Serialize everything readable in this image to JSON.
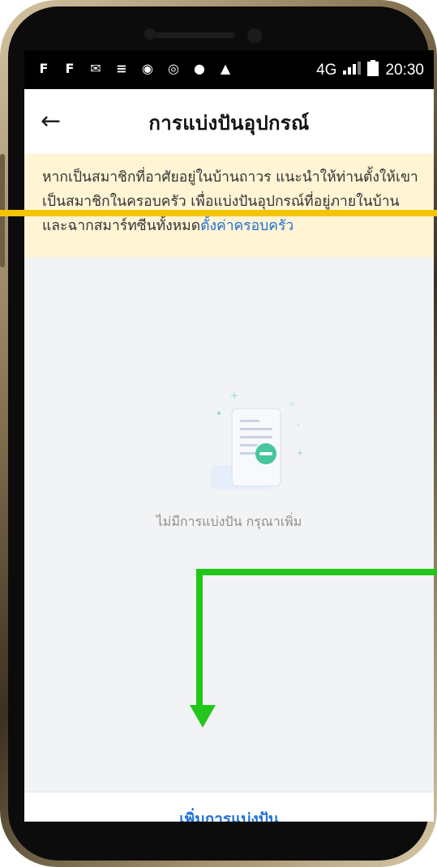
{
  "status_bar": {
    "icons": [
      "F",
      "F",
      "✉",
      "≡",
      "◉",
      "◎",
      "●",
      "▲"
    ],
    "network": "4G",
    "time": "20:30"
  },
  "app_bar": {
    "back_icon": "←",
    "title": "การแบ่งปันอุปกรณ์"
  },
  "banner": {
    "text": "หากเป็นสมาชิกที่อาศัยอยู่ในบ้านถาวร แนะนำให้ท่านตั้งให้เขาเป็นสมาชิกในครอบครัว เพื่อแบ่งปันอุปกรณ์ที่อยู่ภายในบ้านและฉากสมาร์ทซีนทั้งหมด",
    "link": "ตั้งค่าครอบครัว"
  },
  "empty_state": {
    "message": "ไม่มีการแบ่งปัน กรุณาเพิ่ม"
  },
  "bottom": {
    "add_label": "เพิ่มการแบ่งปัน"
  },
  "colors": {
    "accent": "#1f6fd6",
    "banner_bg": "#fff4d4",
    "annotation_green": "#23c61a",
    "annotation_yellow": "#f5c400"
  }
}
